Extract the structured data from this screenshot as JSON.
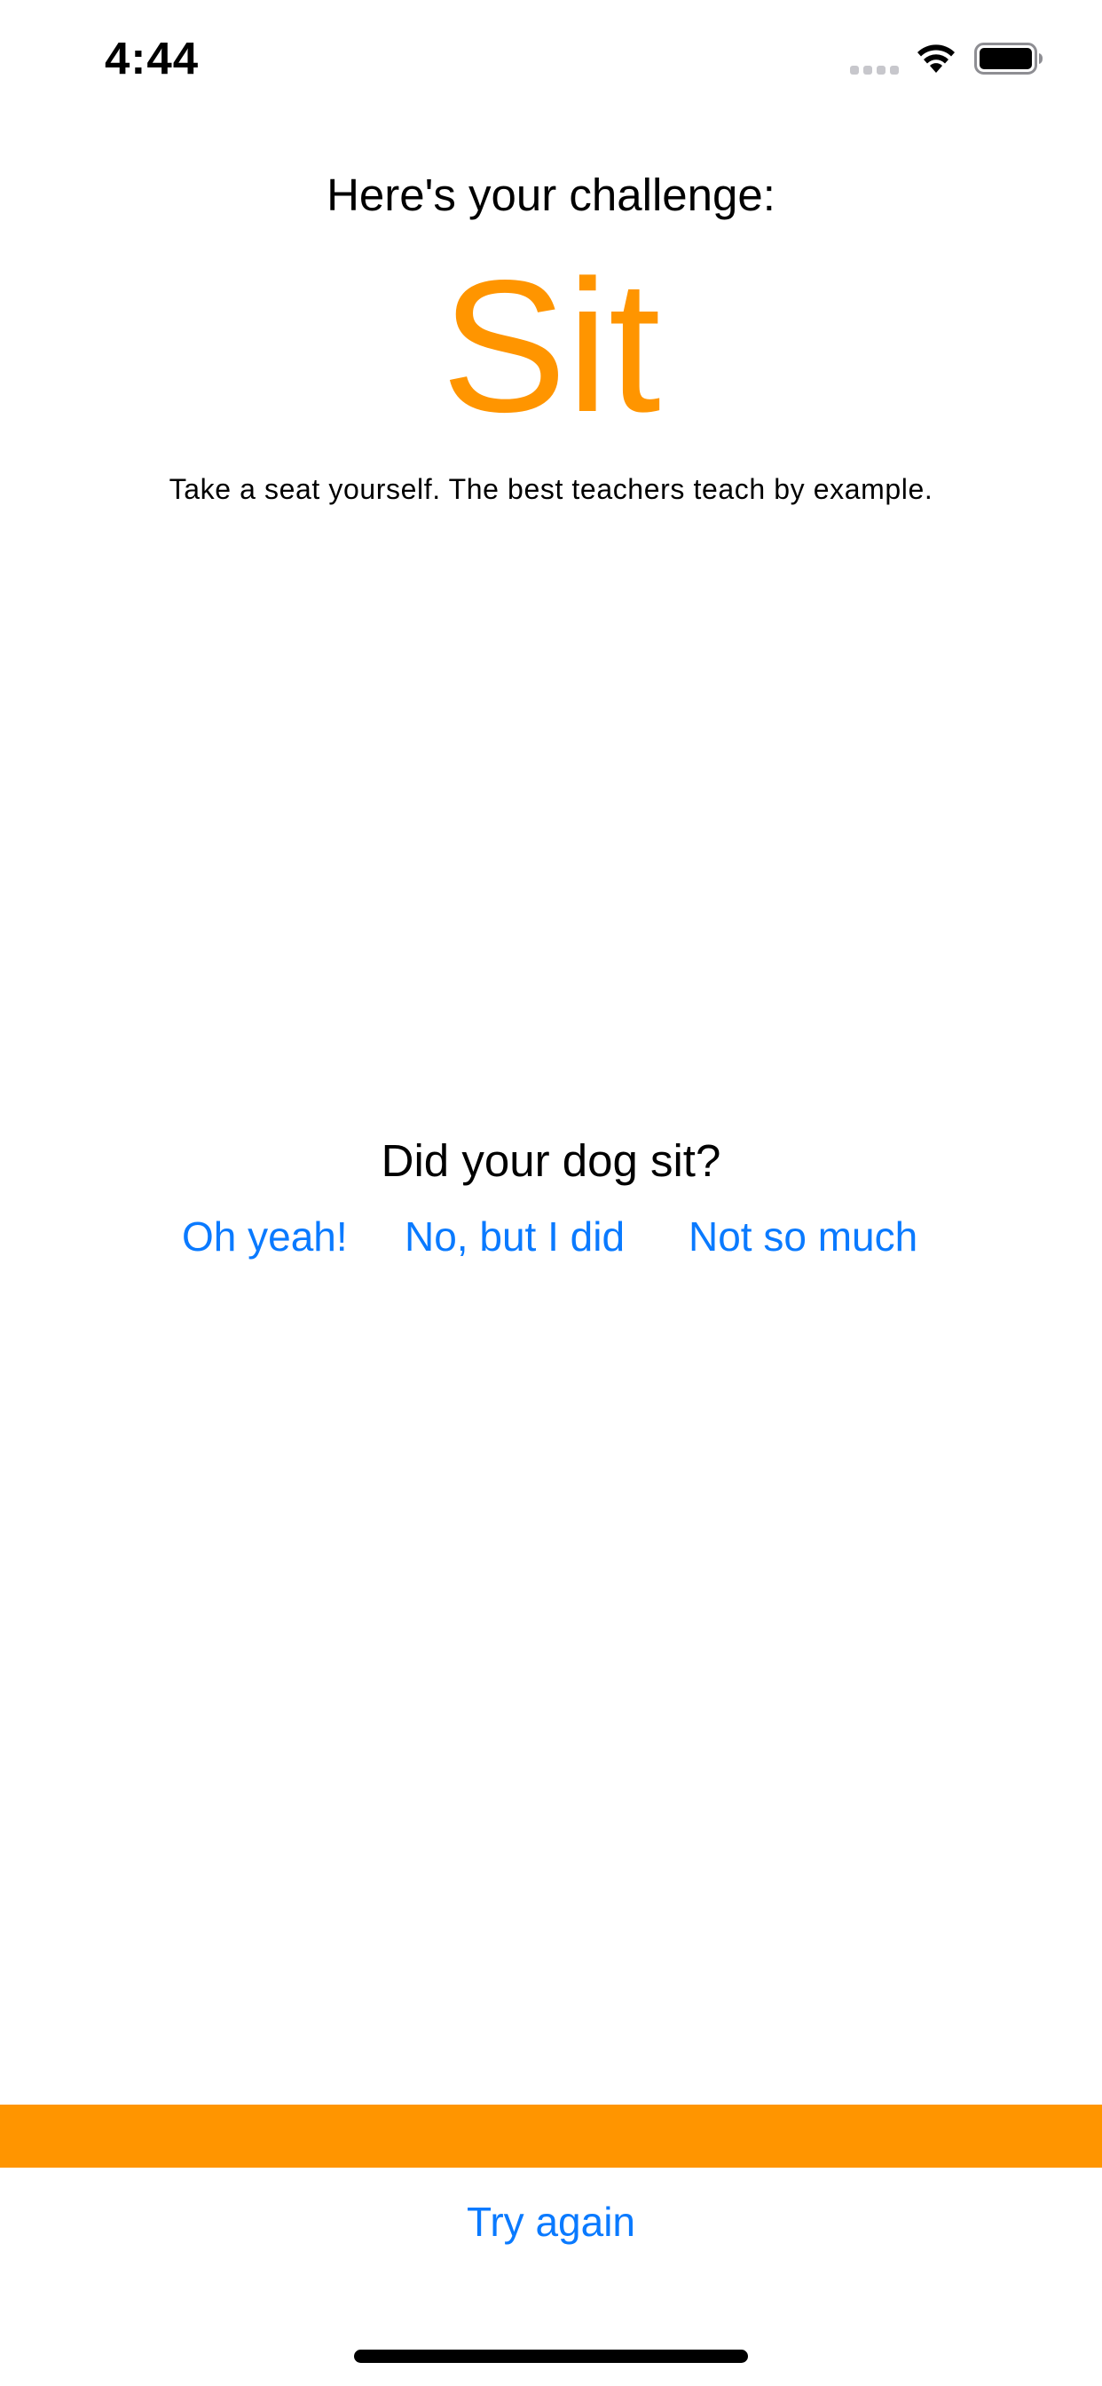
{
  "status_bar": {
    "time": "4:44",
    "icons": [
      "cellular-signal-icon",
      "wifi-icon",
      "battery-icon"
    ]
  },
  "challenge": {
    "heading": "Here's your challenge:",
    "command": "Sit",
    "description": "Take a seat yourself. The best teachers teach by example."
  },
  "question": {
    "label": "Did your dog sit?",
    "answers": [
      "Oh yeah!",
      "No, but I did",
      "Not so much"
    ]
  },
  "footer": {
    "try_again_label": "Try again"
  },
  "colors": {
    "accent": "#ff9500",
    "link": "#0a7aff",
    "text": "#000000",
    "background": "#ffffff"
  }
}
